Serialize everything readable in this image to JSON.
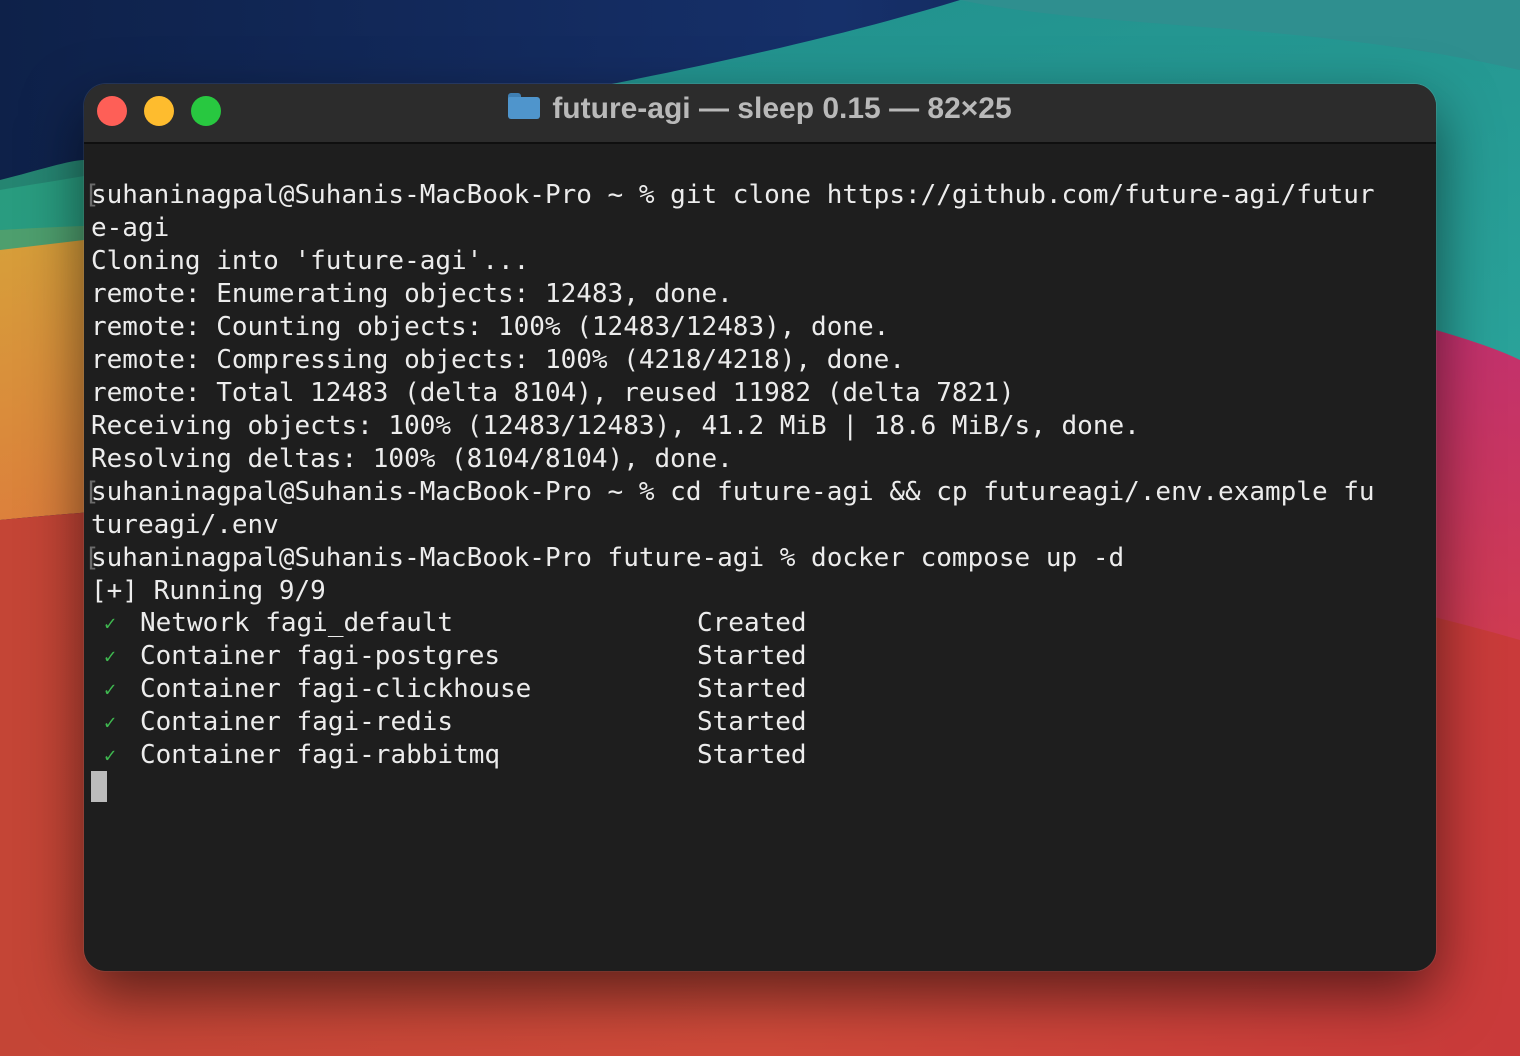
{
  "window": {
    "title": "future-agi — sleep 0.15 — 82×25",
    "folder_icon": "folder-icon",
    "traffic_lights": [
      "close",
      "minimize",
      "zoom"
    ]
  },
  "terminal": {
    "lines": [
      "suhaninagpal@Suhanis-MacBook-Pro ~ % git clone https://github.com/future-agi/futur",
      "e-agi",
      "Cloning into 'future-agi'...",
      "remote: Enumerating objects: 12483, done.",
      "remote: Counting objects: 100% (12483/12483), done.",
      "remote: Compressing objects: 100% (4218/4218), done.",
      "remote: Total 12483 (delta 8104), reused 11982 (delta 7821)",
      "Receiving objects: 100% (12483/12483), 41.2 MiB | 18.6 MiB/s, done.",
      "Resolving deltas: 100% (8104/8104), done.",
      "suhaninagpal@Suhanis-MacBook-Pro ~ % cd future-agi && cp futureagi/.env.example fu",
      "tureagi/.env",
      "suhaninagpal@Suhanis-MacBook-Pro future-agi % docker compose up -d",
      "[+] Running 9/9"
    ],
    "services": [
      {
        "label": "Network fagi_default",
        "status": "Created"
      },
      {
        "label": "Container fagi-postgres",
        "status": "Started"
      },
      {
        "label": "Container fagi-clickhouse",
        "status": "Started"
      },
      {
        "label": "Container fagi-redis",
        "status": "Started"
      },
      {
        "label": "Container fagi-rabbitmq",
        "status": "Started"
      }
    ],
    "check_icon": "✓",
    "prompt_bracket": "["
  },
  "colors": {
    "close": "#fe5f57",
    "minimize": "#febc2e",
    "zoom": "#28c840",
    "check": "#3fb950",
    "text": "#ececec",
    "background": "#1e1e1e"
  }
}
